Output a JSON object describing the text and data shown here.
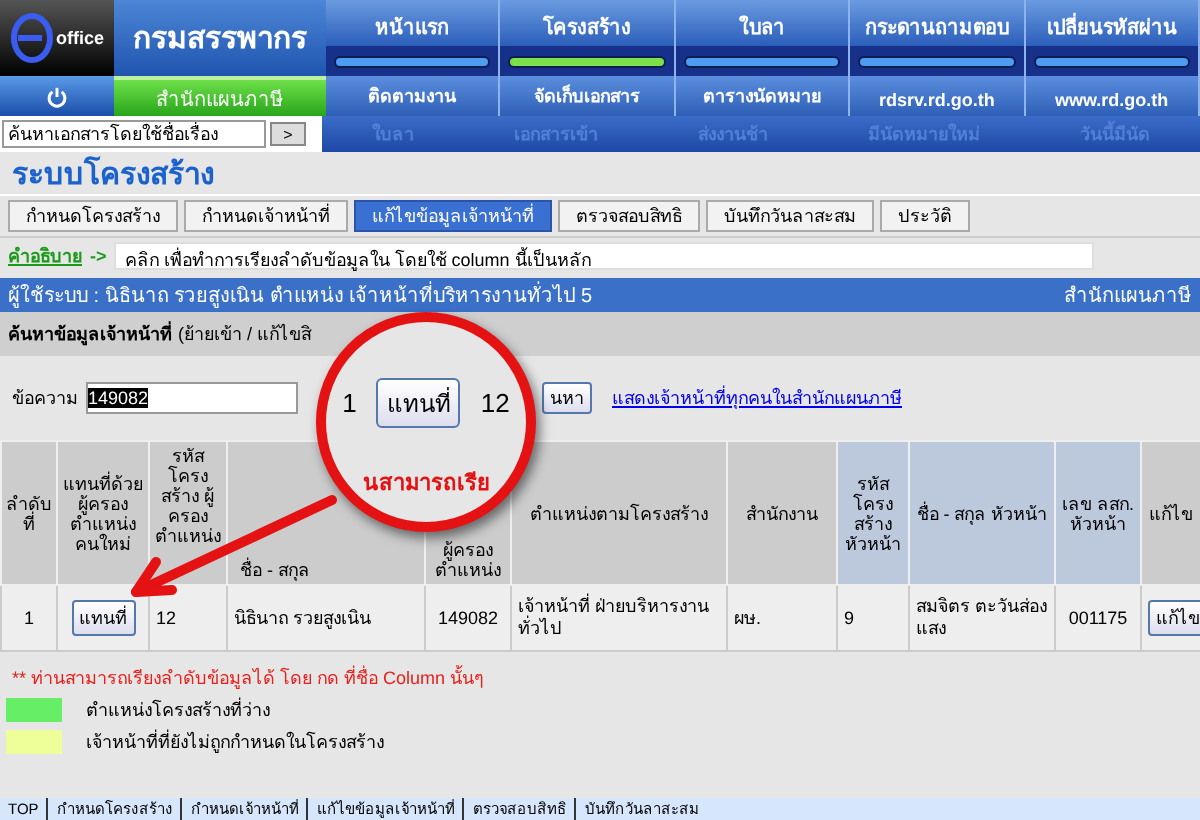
{
  "header": {
    "logo_text": "office",
    "org_name": "กรมสรรพากร",
    "office": "สำนักแผนภาษี",
    "nav": [
      {
        "label": "หน้าแรก",
        "selected": false
      },
      {
        "label": "โครงสร้าง",
        "selected": true
      },
      {
        "label": "ใบลา",
        "selected": false
      },
      {
        "label": "กระดานถามตอบ",
        "selected": false
      },
      {
        "label": "เปลี่ยนรหัสผ่าน",
        "selected": false
      }
    ],
    "subnav": [
      "ติดตามงาน",
      "จัดเก็บเอกสาร",
      "ตารางนัดหมาย",
      "rdsrv.rd.go.th",
      "www.rd.go.th"
    ]
  },
  "doc_search": {
    "value": "ค้นหาเอกสารโดยใช้ชื่อเรื่อง",
    "button": ">"
  },
  "alerts": [
    "ใบลา",
    "เอกสารเข้า",
    "ส่งงานช้า",
    "มีนัดหมายใหม่",
    "วันนี้มีนัด"
  ],
  "page_title": "ระบบโครงสร้าง",
  "tabs": [
    {
      "label": "กำหนดโครงสร้าง",
      "selected": false
    },
    {
      "label": "กำหนดเจ้าหน้าที่",
      "selected": false
    },
    {
      "label": "แก้ไขข้อมูลเจ้าหน้าที่",
      "selected": true
    },
    {
      "label": "ตรวจสอบสิทธิ",
      "selected": false
    },
    {
      "label": "บันทึกวันลาสะสม",
      "selected": false
    },
    {
      "label": "ประวัติ",
      "selected": false
    }
  ],
  "hint": {
    "link": "คำอธิบาย",
    "arrow": "->",
    "text": "คลิก เพื่อทำการเรียงลำดับข้อมูลใน โดยใช้ column นี้เป็นหลัก"
  },
  "user_bar": {
    "text": "ผู้ใช้ระบบ : นิธินาถ รวยสูงเนิน  ตำแหน่ง เจ้าหน้าที่บริหารงานทั่วไป 5",
    "office": "สำนักแผนภาษี"
  },
  "search_panel": {
    "title": "ค้นหาข้อมูลเจ้าหน้าที่",
    "subtitle": "(ย้ายเข้า / แก้ไขสิ",
    "label": "ข้อความ",
    "value": "149082",
    "search_button": "นหา",
    "show_all_link": "แสดงเจ้าหน้าที่ทุกคนในสำนักแผนภาษี"
  },
  "table": {
    "columns": [
      {
        "label": "ลำดับ ที่",
        "kind": "text",
        "highlighted": false
      },
      {
        "label": "แทนที่ด้วย ผู้ครอง ตำแหน่ง คนใหม่",
        "kind": "button",
        "highlighted": false
      },
      {
        "label": "รหัส โครง สร้าง ผู้ ครอง ตำแหน่ง",
        "kind": "text",
        "highlighted": false
      },
      {
        "label": "ชื่อ - สกุล",
        "kind": "text",
        "highlighted": false
      },
      {
        "label": "ผู้ครอง ตำแหน่ง",
        "kind": "text",
        "highlighted": false
      },
      {
        "label": "ตำแหน่งตามโครงสร้าง",
        "kind": "text",
        "highlighted": false
      },
      {
        "label": "สำนักงาน",
        "kind": "text",
        "highlighted": false
      },
      {
        "label": "รหัส โครง สร้าง หัวหน้า",
        "kind": "text",
        "highlighted": true
      },
      {
        "label": "ชื่อ - สกุล หัวหน้า",
        "kind": "text",
        "highlighted": true
      },
      {
        "label": "เลข ลสก. หัวหน้า",
        "kind": "text",
        "highlighted": true
      },
      {
        "label": "แก้ไข",
        "kind": "button",
        "highlighted": false
      }
    ],
    "rows": [
      {
        "cells": [
          "1",
          "แทนที่",
          "12",
          "นิธินาถ รวยสูงเนิน",
          "149082",
          "เจ้าหน้าที่ ฝ่ายบริหารงานทั่วไป",
          "ผษ.",
          "9",
          "สมจิตร ตะวันส่องแสง",
          "001175",
          "แก้ไข"
        ]
      }
    ]
  },
  "note": "** ท่านสามารถเรียงลำดับข้อมูลได้ โดย กด ที่ชื่อ Column นั้นๆ",
  "legend": [
    {
      "label": "ตำแหน่งโครงสร้างที่ว่าง",
      "color": "#66ee66"
    },
    {
      "label": "เจ้าหน้าที่ที่ยังไม่ถูกกำหนดในโครงสร้าง",
      "color": "#eeff99"
    }
  ],
  "footer_links": [
    "TOP",
    "กำหนดโครงสร้าง",
    "กำหนดเจ้าหน้าที่",
    "แก้ไขข้อมูลเจ้าหน้าที่",
    "ตรวจสอบสิทธิ",
    "บันทึกวันลาสะสม"
  ],
  "magnifier": {
    "items": [
      {
        "text": "1",
        "kind": "text"
      },
      {
        "text": "แทนที่",
        "kind": "button"
      },
      {
        "text": "12",
        "kind": "text"
      }
    ],
    "caption": "นสามารถเรีย"
  }
}
